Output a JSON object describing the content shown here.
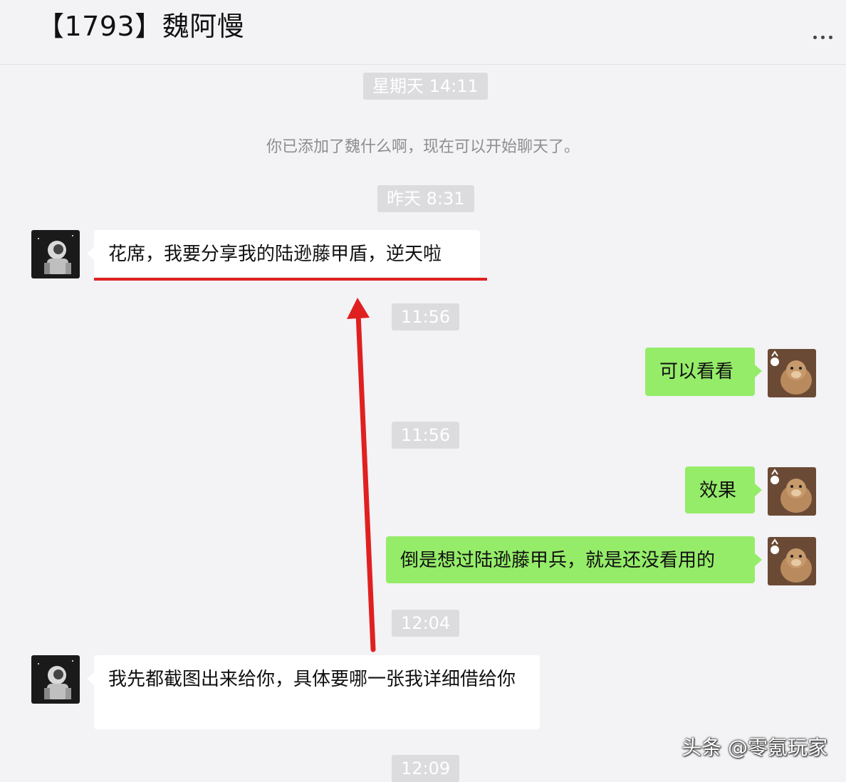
{
  "header": {
    "title": "【1793】魏阿慢",
    "more_icon": "more-dots-icon"
  },
  "messages": {
    "time_1": "星期天 14:11",
    "system_note": "你已添加了魏什么啊，现在可以开始聊天了。",
    "time_2": "昨天 8:31",
    "msg_1": "花席，我要分享我的陆逊藤甲盾，逆天啦",
    "time_3": "11:56",
    "msg_2": "可以看看",
    "time_4": "11:56",
    "msg_3": "效果",
    "msg_4": "倒是想过陆逊藤甲兵，就是还没看用的",
    "time_5": "12:04",
    "msg_5": "我先都截图出来给你，具体要哪一张我详细借给你",
    "time_6": "12:09"
  },
  "watermark": "头条 @零氪玩家",
  "colors": {
    "background": "#f3f2f5",
    "sent_bubble": "#95ec69",
    "received_bubble": "#ffffff",
    "annotation_red": "#e02020",
    "time_pill": "#dcdbde"
  }
}
